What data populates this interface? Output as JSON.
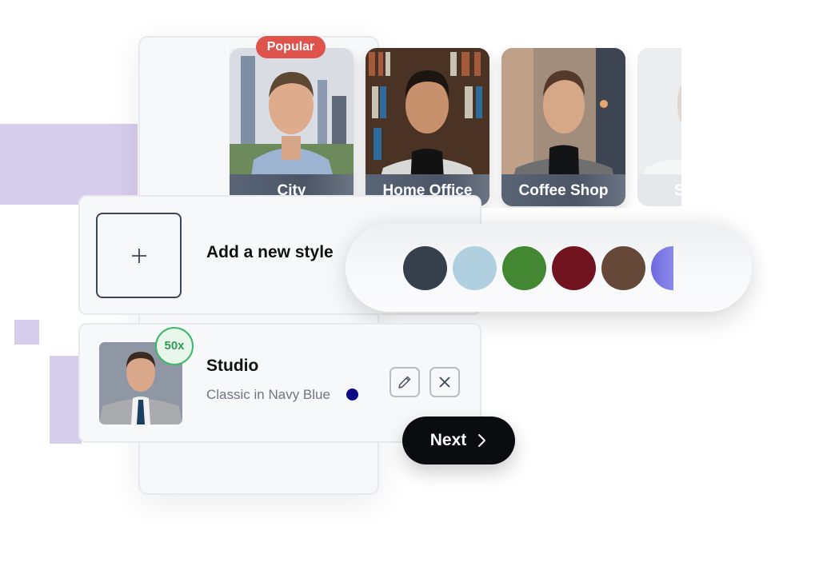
{
  "decor": {
    "accent_color": "#d6cceb"
  },
  "style_cards": [
    {
      "label": "City",
      "badge": "Popular",
      "state": "active"
    },
    {
      "label": "Home Office",
      "state": "active"
    },
    {
      "label": "Coffee Shop",
      "state": "active"
    },
    {
      "label": "S",
      "state": "faded"
    }
  ],
  "popular_badge": {
    "label": "Popular",
    "color": "#e0524c"
  },
  "add_style": {
    "label": "Add a new style",
    "icon": "plus-icon"
  },
  "color_picker": {
    "swatches": [
      {
        "name": "charcoal",
        "color": "#363f4b"
      },
      {
        "name": "light-blue",
        "color": "#b0d0df"
      },
      {
        "name": "green",
        "color": "#438733"
      },
      {
        "name": "burgundy",
        "color": "#711420"
      },
      {
        "name": "brown",
        "color": "#654838"
      },
      {
        "name": "periwinkle",
        "color": "#6d6ae0"
      }
    ]
  },
  "selected_style": {
    "title": "Studio",
    "subtitle": "Classic in Navy Blue",
    "color": "#0a0a86",
    "count_badge": "50x",
    "edit_icon": "pencil-icon",
    "remove_icon": "close-icon"
  },
  "next_button": {
    "label": "Next",
    "icon": "chevron-right-icon"
  }
}
